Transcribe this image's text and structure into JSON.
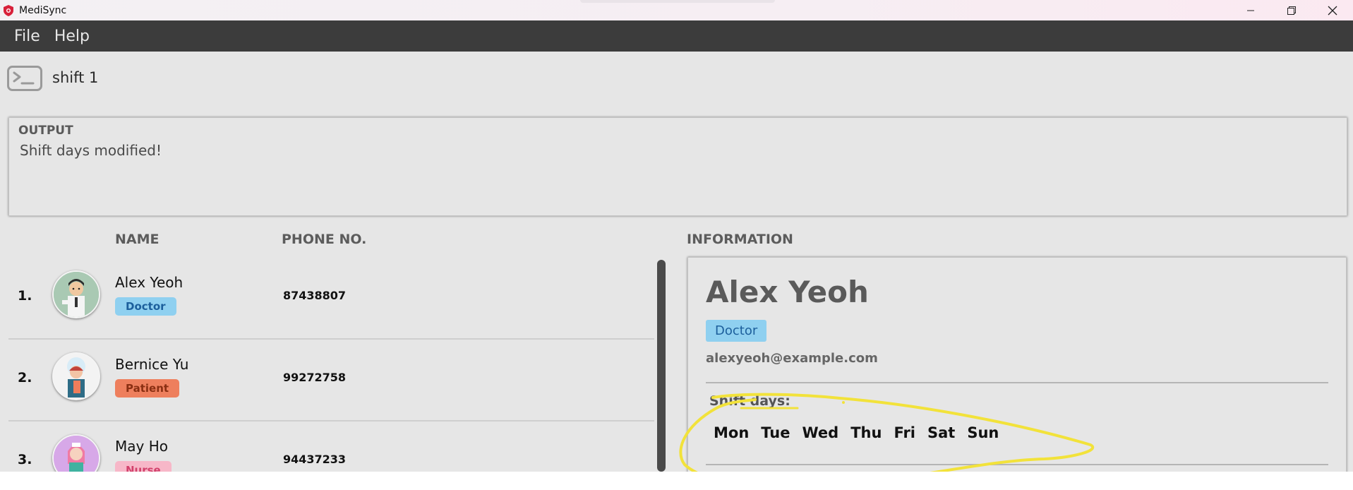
{
  "window": {
    "title": "MediSync"
  },
  "menu": {
    "items": [
      "File",
      "Help"
    ]
  },
  "command": {
    "value": "shift 1"
  },
  "output": {
    "label": "OUTPUT",
    "message": "Shift days modified!"
  },
  "list": {
    "headers": {
      "name": "NAME",
      "phone": "PHONE NO."
    },
    "persons": [
      {
        "index": "1.",
        "name": "Alex Yeoh",
        "tag": "Doctor",
        "phone": "87438807"
      },
      {
        "index": "2.",
        "name": "Bernice Yu",
        "tag": "Patient",
        "phone": "99272758"
      },
      {
        "index": "3.",
        "name": "May Ho",
        "tag": "Nurse",
        "phone": "94437233"
      }
    ]
  },
  "info": {
    "header": "INFORMATION",
    "name": "Alex Yeoh",
    "tag": "Doctor",
    "email": "alexyeoh@example.com",
    "shift_label": "Shift days:",
    "shift_days": [
      "Mon",
      "Tue",
      "Wed",
      "Thu",
      "Fri",
      "Sat",
      "Sun"
    ]
  },
  "icons": {
    "app": "red-shield-icon",
    "minimize": "minimize-icon",
    "maximize": "restore-icon",
    "close": "close-icon",
    "command": "terminal-icon"
  },
  "colors": {
    "menubar": "#3c3c3c",
    "doctor_tag_bg": "#8fd0f0",
    "doctor_tag_text": "#1c5f9c",
    "patient_tag_bg": "#ee7f5d",
    "patient_tag_text": "#8a2f12",
    "nurse_tag_bg": "#f7b7c8",
    "nurse_tag_text": "#d2416c",
    "annotation": "#f2e23a"
  }
}
